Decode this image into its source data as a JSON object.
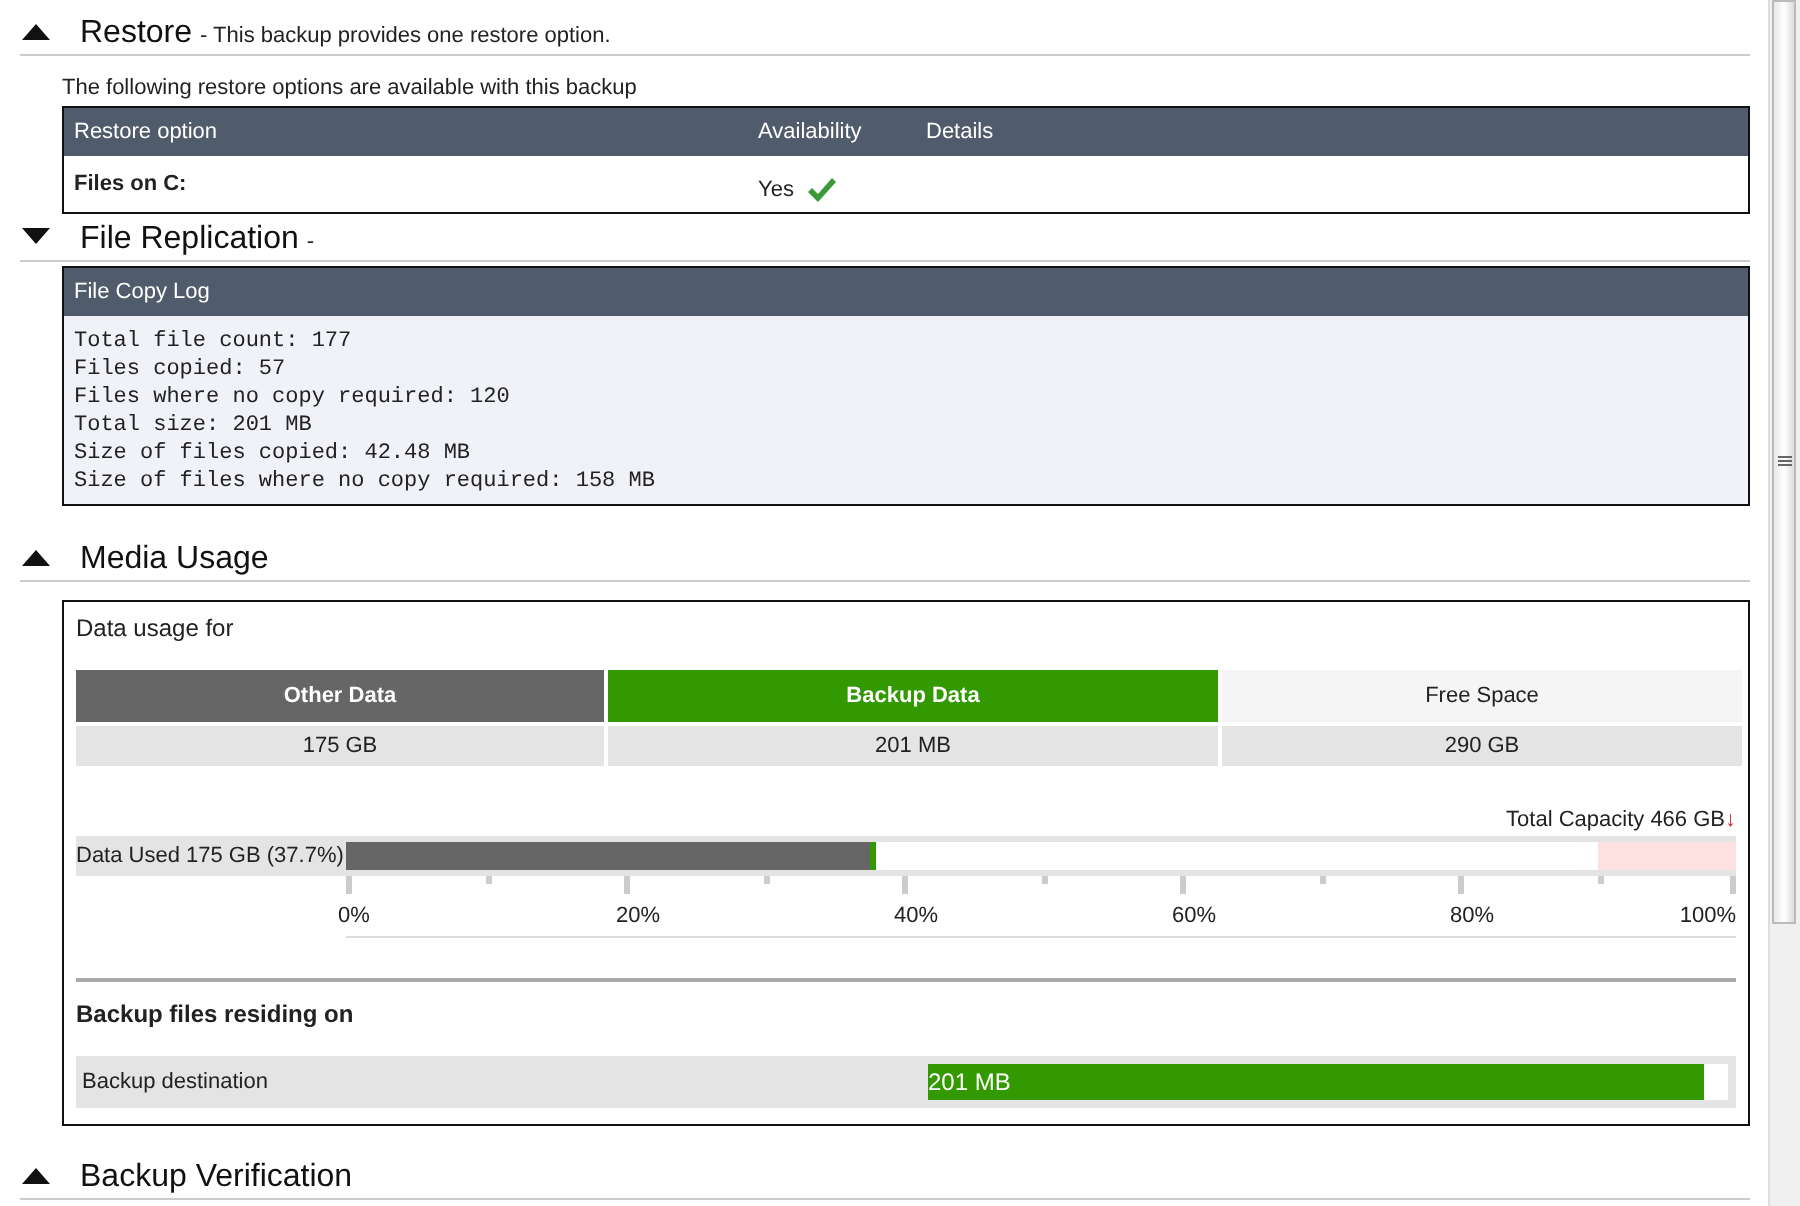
{
  "sections": [
    {
      "kind": "restore",
      "title": "Restore",
      "subtitle": "- This backup provides one restore option.",
      "expanded": true,
      "intro": "The following restore options are available with this backup",
      "table": {
        "columns": [
          "Restore option",
          "Availability",
          "Details"
        ],
        "rows": [
          {
            "option": "Files on C:",
            "availability": "Yes",
            "available": true
          }
        ]
      }
    },
    {
      "kind": "log",
      "title": "File Replication",
      "subtitle": "-",
      "expanded": false,
      "log_title": "File Copy Log",
      "lines": [
        "Total file count: 177",
        "Files copied: 57",
        "Files where no copy required: 120",
        "Total size: 201 MB",
        "Size of files copied: 42.48 MB",
        "Size of files where no copy required: 158 MB"
      ]
    },
    {
      "kind": "media",
      "title": "Media Usage",
      "expanded": true,
      "caption": "Data usage for",
      "usage": [
        {
          "label": "Other Data",
          "value": "175 GB",
          "color": "#666666"
        },
        {
          "label": "Backup Data",
          "value": "201 MB",
          "color": "#339900"
        },
        {
          "label": "Free Space",
          "value": "290 GB",
          "color": "#f5f5f5"
        }
      ],
      "capacity": "Total Capacity 466 GB",
      "capacity_marker": "↓",
      "data_used": {
        "label": "Data Used 175 GB (37.7%)",
        "level": 0.377
      },
      "axis_labels": [
        "0%",
        "20%",
        "40%",
        "60%",
        "80%",
        "100%"
      ],
      "residing_title": "Backup files residing on",
      "destination": {
        "label": "Backup destination",
        "value": "201 MB",
        "level": 0.97
      }
    },
    {
      "kind": "header",
      "title": "Backup Verification",
      "expanded": true
    }
  ]
}
